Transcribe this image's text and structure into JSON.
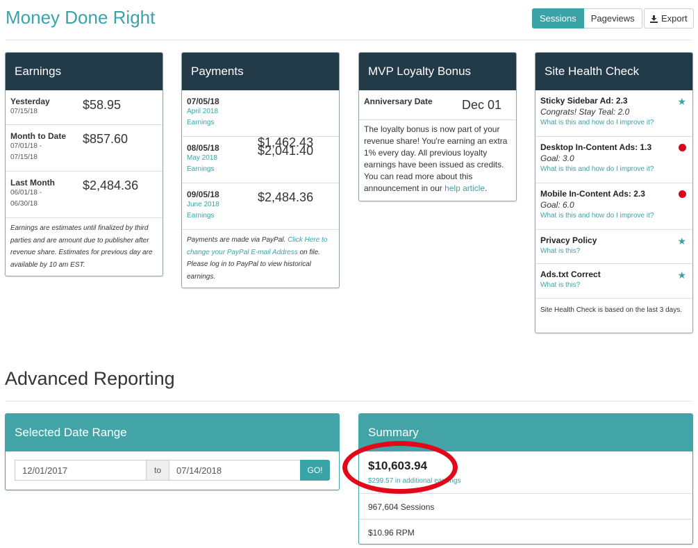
{
  "header": {
    "site_title": "Money Done Right",
    "toggle": {
      "sessions_label": "Sessions",
      "pageviews_label": "Pageviews",
      "active": "Sessions"
    },
    "export_label": "Export"
  },
  "earnings": {
    "title": "Earnings",
    "rows": [
      {
        "label": "Yesterday",
        "date_line1": "07/15/18",
        "date_line2": "",
        "amount": "$58.95"
      },
      {
        "label": "Month to Date",
        "date_line1": "07/01/18 -",
        "date_line2": "07/15/18",
        "amount": "$857.60"
      },
      {
        "label": "Last Month",
        "date_line1": "06/01/18 -",
        "date_line2": "06/30/18",
        "amount": "$2,484.36"
      }
    ],
    "note": "Earnings are estimates until finalized by third parties and are amount due to publisher after revenue share. Estimates for previous day are available by 10 am EST."
  },
  "payments": {
    "title": "Payments",
    "rows": [
      {
        "date": "07/05/18",
        "period": "April 2018",
        "period_sub": "Earnings",
        "amount": "$1,462.43"
      },
      {
        "date": "08/05/18",
        "period": "May 2018",
        "period_sub": "Earnings",
        "amount": "$2,041.40"
      },
      {
        "date": "09/05/18",
        "period": "June 2018",
        "period_sub": "Earnings",
        "amount": "$2,484.36"
      }
    ],
    "note_pre": "Payments are made via PayPal. ",
    "note_link": "Click Here to change your PayPal E-mail Address",
    "note_post": " on file. Please log in to PayPal to view historical earnings."
  },
  "loyalty": {
    "title": "MVP Loyalty Bonus",
    "anniversary_label": "Anniversary Date",
    "anniversary_value": "Dec 01",
    "body": "The loyalty bonus is now part of your revenue share! You're earning an extra 1% every day. All previous loyalty earnings have been issued as credits. You can read more about this announcement in our ",
    "link": "help article",
    "body_end": "."
  },
  "health": {
    "title": "Site Health Check",
    "items": [
      {
        "title": "Sticky Sidebar Ad: 2.3",
        "goal": "Congrats! Stay Teal: 2.0",
        "link": "What is this and how do I improve it?",
        "status": "star"
      },
      {
        "title": "Desktop In-Content Ads: 1.3",
        "goal": "Goal: 3.0",
        "link": "What is this and how do I improve it?",
        "status": "red"
      },
      {
        "title": "Mobile In-Content Ads: 2.3",
        "goal": "Goal: 6.0",
        "link": "What is this and how do I improve it?",
        "status": "red"
      },
      {
        "title": "Privacy Policy",
        "goal": "",
        "link": "What is this?",
        "status": "star"
      },
      {
        "title": "Ads.txt Correct",
        "goal": "",
        "link": "What is this?",
        "status": "star"
      }
    ],
    "note": "Site Health Check is based on the last 3 days.",
    "status_colors": {
      "star": "#3aa3a8",
      "red": "#d9041c"
    }
  },
  "advanced": {
    "section_title": "Advanced Reporting",
    "date_range": {
      "title": "Selected Date Range",
      "start": "12/01/2017",
      "to_label": "to",
      "end": "07/14/2018",
      "go_label": "GO!"
    },
    "summary": {
      "title": "Summary",
      "total": "$10,603.94",
      "extra": "$299.57 in additional earnings",
      "sessions": "967,604 Sessions",
      "rpm": "$10.96 RPM"
    }
  },
  "colors": {
    "teal": "#3aa3a8",
    "navy": "#233a49",
    "highlight_circle": "#e2081a"
  }
}
